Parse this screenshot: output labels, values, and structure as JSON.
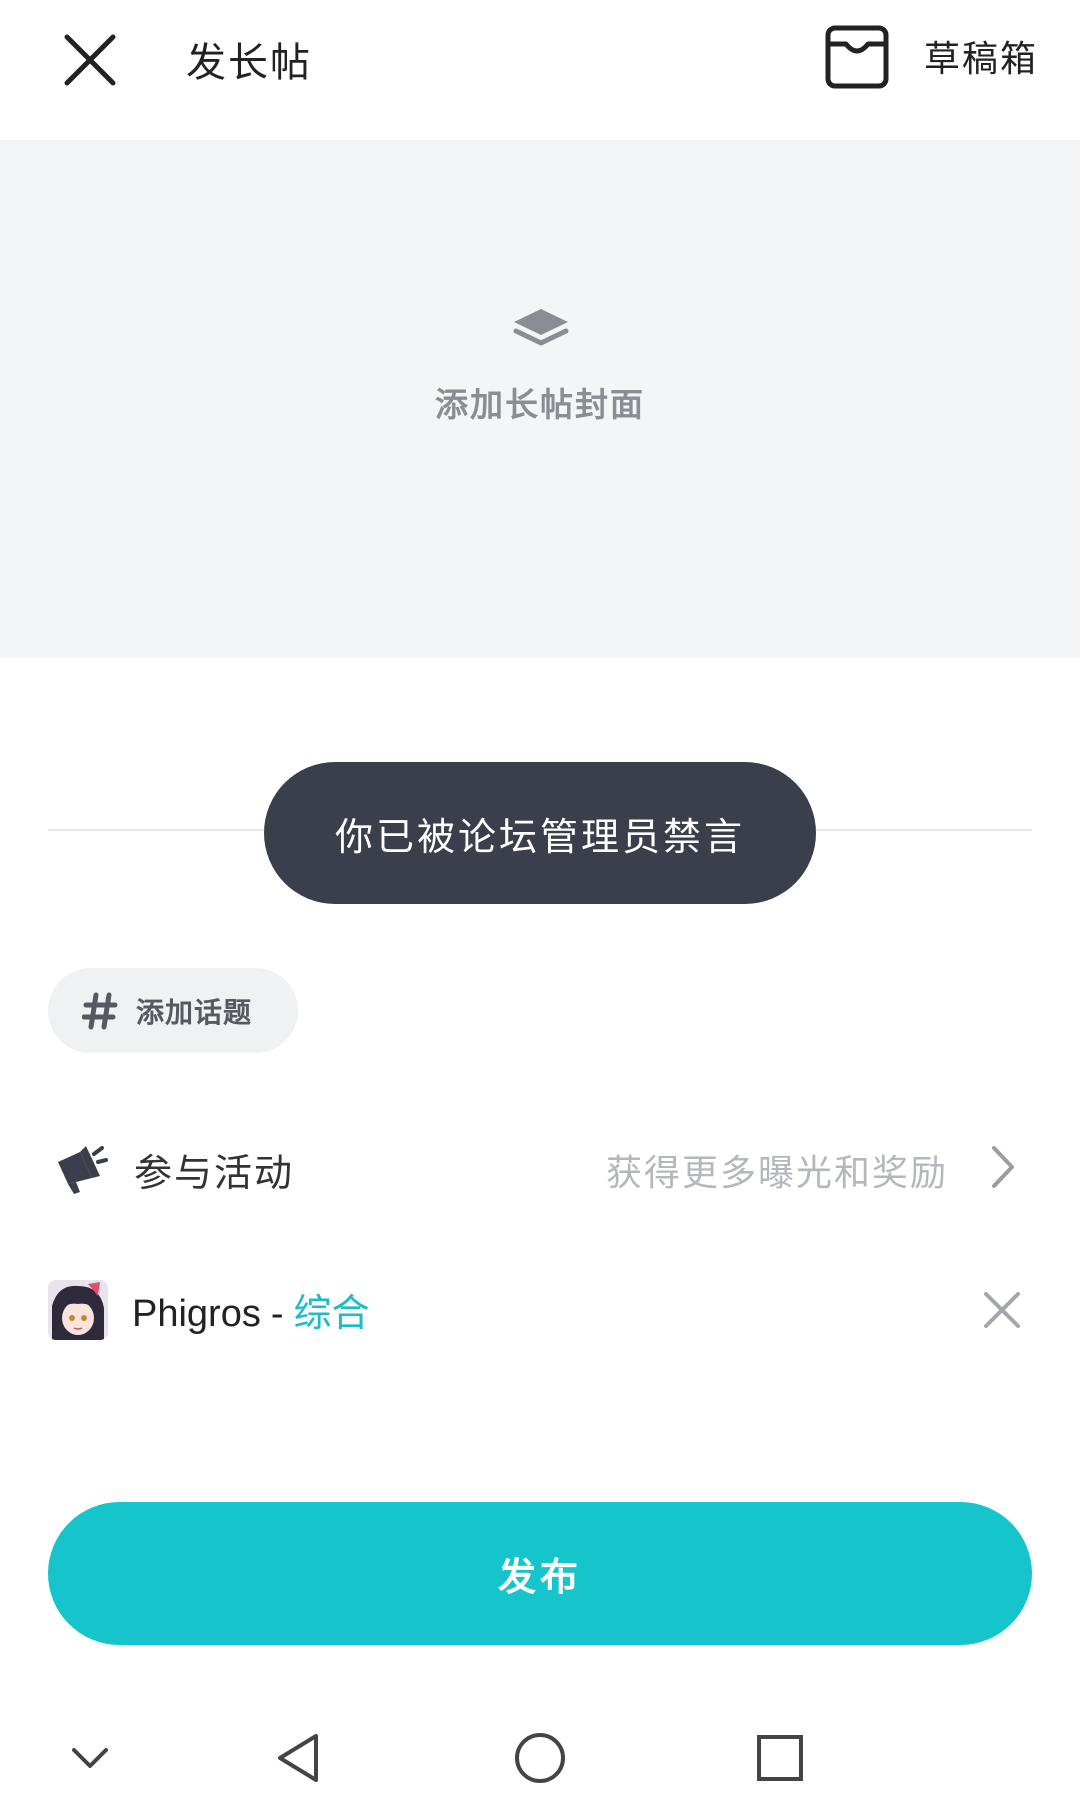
{
  "header": {
    "title": "发长帖",
    "draft_label": "草稿箱"
  },
  "cover": {
    "label": "添加长帖封面"
  },
  "toast": {
    "message": "你已被论坛管理员禁言"
  },
  "topic": {
    "label": "添加话题"
  },
  "activity": {
    "label": "参与活动",
    "hint": "获得更多曝光和奖励"
  },
  "forum": {
    "name": "Phigros",
    "separator": "-",
    "section": "综合"
  },
  "publish": {
    "label": "发布"
  },
  "icons": {
    "close": "close-icon",
    "draft": "inbox-icon",
    "cover": "layers-icon",
    "topic": "hash-icon",
    "activity": "megaphone-icon",
    "chevron": "chevron-right-icon",
    "remove": "close-icon",
    "nav": [
      "chevron-down-icon",
      "back-triangle-icon",
      "home-circle-icon",
      "recents-square-icon"
    ]
  },
  "colors": {
    "accent": "#16c5cc",
    "section_text": "#1bbbc7",
    "toast_bg": "#3b3f4c",
    "cover_bg": "#f4f5f7"
  }
}
